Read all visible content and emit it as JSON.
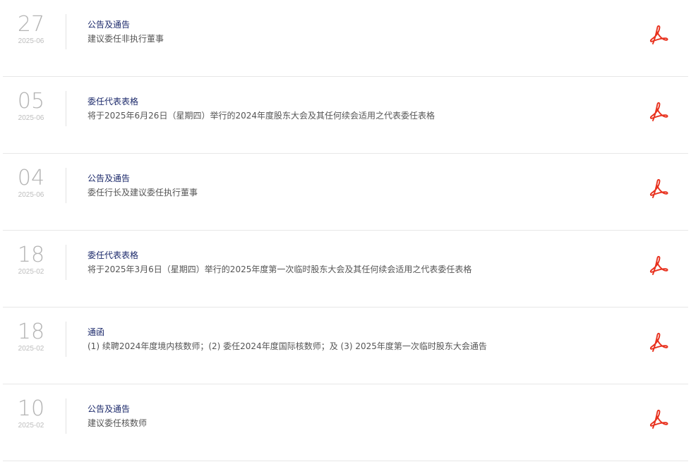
{
  "items": [
    {
      "day": "27",
      "month": "2025-06",
      "category": "公告及通告",
      "title": "建议委任非执行董事"
    },
    {
      "day": "05",
      "month": "2025-06",
      "category": "委任代表表格",
      "title": "将于2025年6月26日（星期四）举行的2024年度股东大会及其任何续会适用之代表委任表格"
    },
    {
      "day": "04",
      "month": "2025-06",
      "category": "公告及通告",
      "title": "委任行长及建议委任执行董事"
    },
    {
      "day": "18",
      "month": "2025-02",
      "category": "委任代表表格",
      "title": "将于2025年3月6日（星期四）举行的2025年度第一次临时股东大会及其任何续会适用之代表委任表格"
    },
    {
      "day": "18",
      "month": "2025-02",
      "category": "通函",
      "title": "(1) 续聘2024年度境内核数师；(2) 委任2024年度国际核数师；及 (3) 2025年度第一次临时股东大会通告"
    },
    {
      "day": "10",
      "month": "2025-02",
      "category": "公告及通告",
      "title": "建议委任核数师"
    }
  ],
  "colors": {
    "pdf_icon": "#e8311e",
    "category": "#1c2a6b",
    "title": "#555555",
    "date": "#b4b4b4"
  },
  "icons": {
    "download": "pdf-icon"
  }
}
